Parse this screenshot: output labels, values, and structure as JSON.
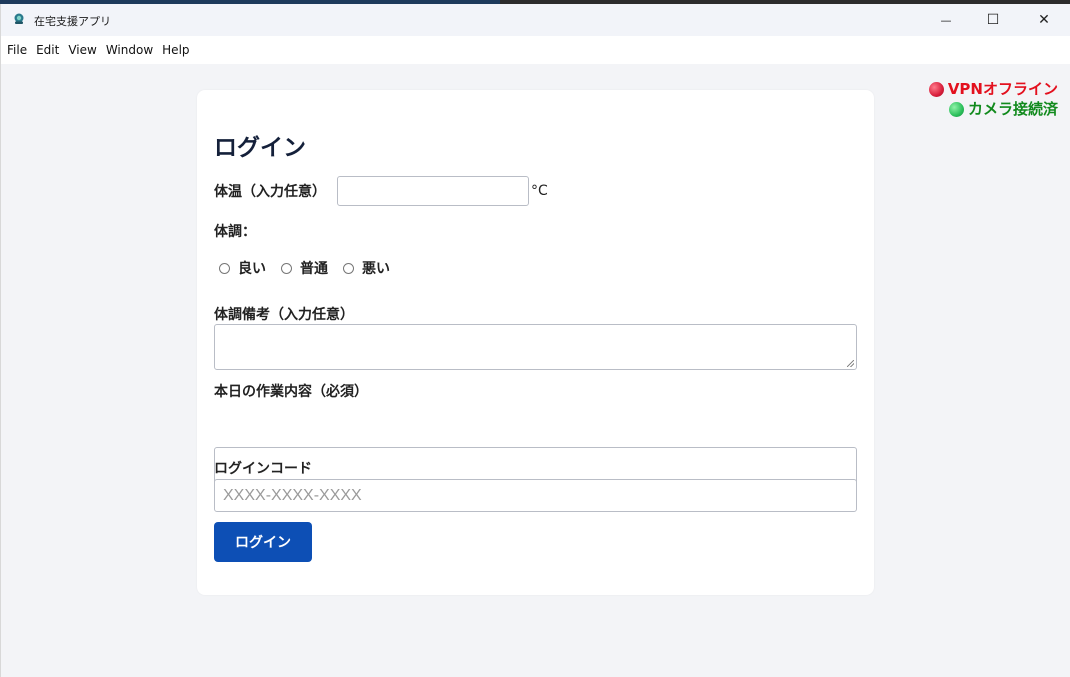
{
  "window": {
    "title": "在宅支援アプリ",
    "icon": "app-logo-icon",
    "controls": {
      "minimize": "—",
      "maximize": "☐",
      "close": "✕"
    }
  },
  "menu": {
    "items": [
      "File",
      "Edit",
      "View",
      "Window",
      "Help"
    ]
  },
  "status": {
    "vpn": {
      "text": "VPNオフライン",
      "color": "#e3101e",
      "dot_color": "red"
    },
    "camera": {
      "text": "カメラ接続済",
      "color": "#118a1d",
      "dot_color": "green"
    }
  },
  "form": {
    "title": "ログイン",
    "temperature_label": "体温（入力任意）",
    "temperature_value": "",
    "temperature_unit": "°C",
    "condition_label": "体調：",
    "condition_options": [
      "良い",
      "普通",
      "悪い"
    ],
    "condition_notes_label": "体調備考（入力任意）",
    "condition_notes_value": "",
    "work_content_label": "本日の作業内容（必須）",
    "work_content_value": "",
    "login_code_label": "ログインコード",
    "login_code_placeholder": "XXXX-XXXX-XXXX",
    "login_button": "ログイン"
  },
  "colors": {
    "primary_button": "#0d4fb5",
    "card_bg": "#ffffff",
    "page_bg": "#f3f4f7"
  }
}
